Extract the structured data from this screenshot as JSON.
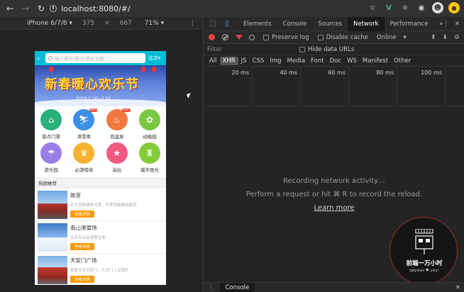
{
  "browser": {
    "url": "localhost:8080/#/",
    "extensions": [
      "star-icon",
      "vue-devtools-icon",
      "react-icon",
      "record-icon",
      "avatar",
      "menu-icon"
    ]
  },
  "device_toolbar": {
    "device": "iPhone 6/7/8",
    "width": "375",
    "times": "×",
    "height": "667",
    "zoom": "71%"
  },
  "mobile": {
    "search_placeholder": "输入城市/景点/游玩主题",
    "city": "北京",
    "banner_title": "新春暖心欢乐节",
    "banner_sub": "2018.2.16~2.20",
    "icons": [
      {
        "label": "景点门票",
        "color": "#2ab07a",
        "glyph": "⌂",
        "hot": false
      },
      {
        "label": "滑雪季",
        "color": "#3b8fe6",
        "glyph": "⛷",
        "hot": true
      },
      {
        "label": "泡温泉",
        "color": "#f0783c",
        "glyph": "♨",
        "hot": true
      },
      {
        "label": "动植园",
        "color": "#7ac943",
        "glyph": "✿",
        "hot": false
      },
      {
        "label": "游乐园",
        "color": "#9b7de8",
        "glyph": "☂",
        "hot": false
      },
      {
        "label": "必游榜单",
        "color": "#f5b22c",
        "glyph": "♛",
        "hot": false
      },
      {
        "label": "演出",
        "color": "#f05a7e",
        "glyph": "★",
        "hot": false
      },
      {
        "label": "城市观光",
        "color": "#86cc3a",
        "glyph": "♜",
        "hot": false
      }
    ],
    "hot_label": "HOT",
    "section_title": "热销推荐",
    "items": [
      {
        "name": "故宫",
        "desc": "东方宫殿建筑代表，世界宫殿建筑典范",
        "btn": "查看详情"
      },
      {
        "name": "南山滑雪场",
        "desc": "北京专业级滑雪圣地",
        "btn": "查看详情"
      },
      {
        "name": "天安门广场",
        "desc": "我爱北京天安门，天安门上太阳升",
        "btn": "查看详情"
      }
    ]
  },
  "devtools": {
    "tabs": [
      "Elements",
      "Console",
      "Sources",
      "Network",
      "Performance"
    ],
    "active_tab": "Network",
    "more": "»",
    "preserve_log": "Preserve log",
    "disable_cache": "Disable cache",
    "throttle": "Online",
    "filter_placeholder": "Filter",
    "hide_data_urls": "Hide data URLs",
    "types": [
      "All",
      "XHR",
      "JS",
      "CSS",
      "Img",
      "Media",
      "Font",
      "Doc",
      "WS",
      "Manifest",
      "Other"
    ],
    "active_type": "XHR",
    "ticks": [
      "20 ms",
      "40 ms",
      "60 ms",
      "80 ms",
      "100 ms"
    ],
    "empty_line1": "Recording network activity…",
    "empty_line2": "Perform a request or hit ⌘ R to record the reload.",
    "learn_more": "Learn more",
    "drawer_tab": "Console"
  },
  "watermark": {
    "text": "前端一万小时",
    "sub": "qdywxs ♥ you!"
  }
}
